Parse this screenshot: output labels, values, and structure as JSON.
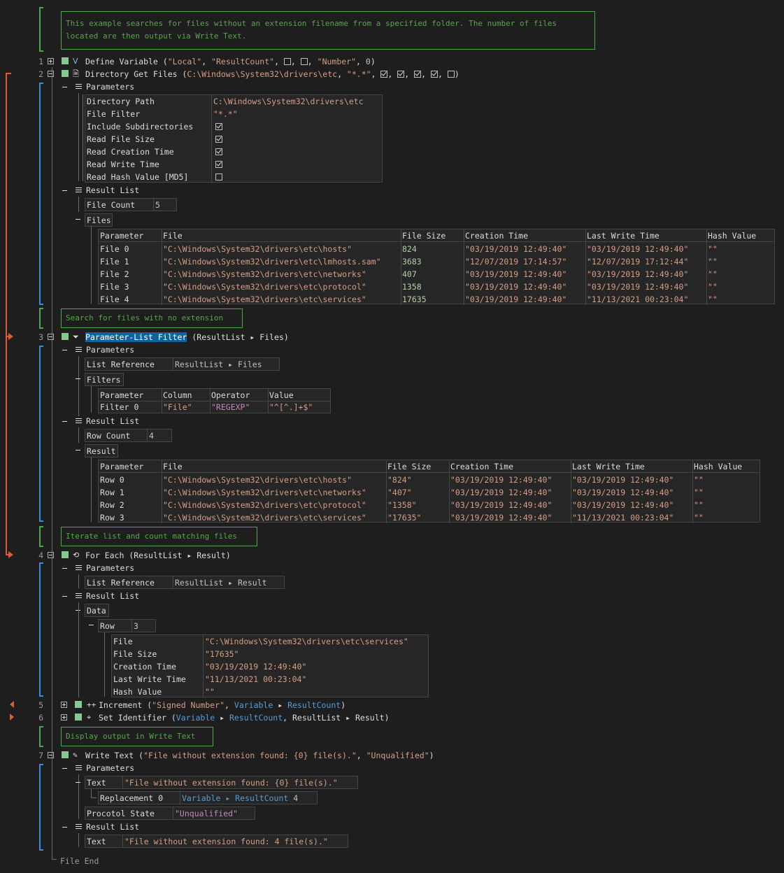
{
  "comments": {
    "intro": "This example searches for files without an extension filename from a specified folder. The number of files\nlocated are then output via Write Text.",
    "c1": "Search for files with no extension",
    "c2": "Iterate list and count matching files",
    "c3": "Display output in Write Text"
  },
  "lines": {
    "l1": {
      "num": "1",
      "cmd": "Define Variable",
      "args": [
        "\"Local\"",
        "\"ResultCount\"",
        "\"Number\"",
        "0"
      ]
    },
    "l2": {
      "num": "2",
      "cmd": "Directory Get Files",
      "path": "C:\\Windows\\System32\\drivers\\etc",
      "filter": "\"*.*\""
    },
    "l3": {
      "num": "3",
      "cmd": "Parameter-List Filter",
      "ref": "ResultList ▸ Files"
    },
    "l4": {
      "num": "4",
      "cmd": "For Each",
      "ref": "ResultList ▸ Result"
    },
    "l5": {
      "num": "5",
      "cmd": "Increment",
      "arg1": "\"Signed Number\"",
      "arg2a": "Variable",
      "arg2b": "ResultCount"
    },
    "l6": {
      "num": "6",
      "cmd": "Set Identifier",
      "arg1a": "Variable",
      "arg1b": "ResultCount",
      "arg2": "ResultList ▸ Result"
    },
    "l7": {
      "num": "7",
      "cmd": "Write Text",
      "arg1": "\"File without extension found: {0} file(s).\"",
      "arg2": "\"Unqualified\""
    }
  },
  "labels": {
    "parameters": "Parameters",
    "result_list": "Result List",
    "files": "Files",
    "filters": "Filters",
    "result": "Result",
    "data": "Data",
    "row": "Row",
    "row_val": "3",
    "file_end": "File End"
  },
  "dgf_params": [
    {
      "k": "Directory Path",
      "v": "C:\\Windows\\System32\\drivers\\etc",
      "type": "text"
    },
    {
      "k": "File Filter",
      "v": "\"*.*\"",
      "type": "text"
    },
    {
      "k": "Include Subdirectories",
      "type": "check",
      "on": true
    },
    {
      "k": "Read File Size",
      "type": "check",
      "on": true
    },
    {
      "k": "Read Creation Time",
      "type": "check",
      "on": true
    },
    {
      "k": "Read Write Time",
      "type": "check",
      "on": true
    },
    {
      "k": "Read Hash Value [MD5]",
      "type": "check",
      "on": false
    }
  ],
  "file_count": {
    "k": "File Count",
    "v": "5"
  },
  "files_table": {
    "headers": [
      "Parameter",
      "File",
      "File Size",
      "Creation Time",
      "Last Write Time",
      "Hash Value"
    ],
    "rows": [
      [
        "File 0",
        "\"C:\\Windows\\System32\\drivers\\etc\\hosts\"",
        "824",
        "\"03/19/2019 12:49:40\"",
        "\"03/19/2019 12:49:40\"",
        "\"\""
      ],
      [
        "File 1",
        "\"C:\\Windows\\System32\\drivers\\etc\\lmhosts.sam\"",
        "3683",
        "\"12/07/2019 17:14:57\"",
        "\"12/07/2019 17:12:44\"",
        "\"\""
      ],
      [
        "File 2",
        "\"C:\\Windows\\System32\\drivers\\etc\\networks\"",
        "407",
        "\"03/19/2019 12:49:40\"",
        "\"03/19/2019 12:49:40\"",
        "\"\""
      ],
      [
        "File 3",
        "\"C:\\Windows\\System32\\drivers\\etc\\protocol\"",
        "1358",
        "\"03/19/2019 12:49:40\"",
        "\"03/19/2019 12:49:40\"",
        "\"\""
      ],
      [
        "File 4",
        "\"C:\\Windows\\System32\\drivers\\etc\\services\"",
        "17635",
        "\"03/19/2019 12:49:40\"",
        "\"11/13/2021 00:23:04\"",
        "\"\""
      ]
    ]
  },
  "plf": {
    "list_ref_k": "List Reference",
    "list_ref_v": "ResultList ▸ Files",
    "filters_headers": [
      "Parameter",
      "Column",
      "Operator",
      "Value"
    ],
    "filters_row": [
      "Filter 0",
      "\"File\"",
      "\"REGEXP\"",
      "\"^[^.]+$\""
    ],
    "row_count_k": "Row Count",
    "row_count_v": "4"
  },
  "result_table": {
    "headers": [
      "Parameter",
      "File",
      "File Size",
      "Creation Time",
      "Last Write Time",
      "Hash Value"
    ],
    "rows": [
      [
        "Row 0",
        "\"C:\\Windows\\System32\\drivers\\etc\\hosts\"",
        "\"824\"",
        "\"03/19/2019 12:49:40\"",
        "\"03/19/2019 12:49:40\"",
        "\"\""
      ],
      [
        "Row 1",
        "\"C:\\Windows\\System32\\drivers\\etc\\networks\"",
        "\"407\"",
        "\"03/19/2019 12:49:40\"",
        "\"03/19/2019 12:49:40\"",
        "\"\""
      ],
      [
        "Row 2",
        "\"C:\\Windows\\System32\\drivers\\etc\\protocol\"",
        "\"1358\"",
        "\"03/19/2019 12:49:40\"",
        "\"03/19/2019 12:49:40\"",
        "\"\""
      ],
      [
        "Row 3",
        "\"C:\\Windows\\System32\\drivers\\etc\\services\"",
        "\"17635\"",
        "\"03/19/2019 12:49:40\"",
        "\"11/13/2021 00:23:04\"",
        "\"\""
      ]
    ]
  },
  "foreach": {
    "list_ref_k": "List Reference",
    "list_ref_v": "ResultList ▸ Result",
    "data_rows": [
      {
        "k": "File",
        "v": "\"C:\\Windows\\System32\\drivers\\etc\\services\""
      },
      {
        "k": "File Size",
        "v": "\"17635\""
      },
      {
        "k": "Creation Time",
        "v": "\"03/19/2019 12:49:40\""
      },
      {
        "k": "Last Write Time",
        "v": "\"11/13/2021 00:23:04\""
      },
      {
        "k": "Hash Value",
        "v": "\"\""
      }
    ]
  },
  "writetext": {
    "text_k": "Text",
    "text_v": "\"File without extension found: {0} file(s).\"",
    "repl_k": "Replacement 0",
    "repl_v1": "Variable",
    "repl_v2": "ResultCount",
    "repl_v3": "4",
    "proto_k": "Procotol State",
    "proto_v": "\"Unqualified\"",
    "out_k": "Text",
    "out_v": "\"File without extension found: 4 file(s).\""
  }
}
